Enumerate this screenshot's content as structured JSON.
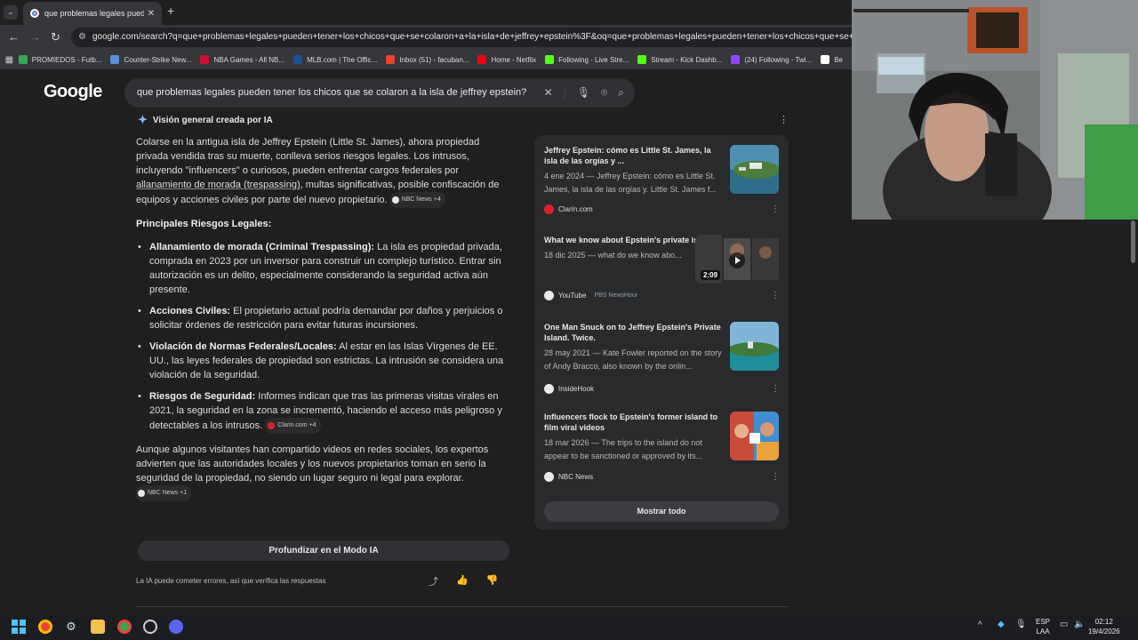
{
  "browser": {
    "tab_title": "que problemas legales pueden",
    "url": "google.com/search?q=que+problemas+legales+pueden+tener+los+chicos+que+se+colaron+a+la+isla+de+jeffrey+epstein%3F&oq=que+problemas+legales+pueden+tener+los+chicos+que+se+colaron+a",
    "bookmarks": [
      {
        "label": "PROMIEDOS - Futb...",
        "color": "#3aa757"
      },
      {
        "label": "Counter-Strike New...",
        "color": "#5a8fd6"
      },
      {
        "label": "NBA Games - All NB...",
        "color": "#c8102e"
      },
      {
        "label": "MLB.com | The Offic...",
        "color": "#1d4f91"
      },
      {
        "label": "Inbox (51) - facuban...",
        "color": "#ea4335"
      },
      {
        "label": "Home - Netflix",
        "color": "#e50914"
      },
      {
        "label": "Following - Live Stre...",
        "color": "#53fc18"
      },
      {
        "label": "Stream - Kick Dashb...",
        "color": "#53fc18"
      },
      {
        "label": "(24) Following - Twi...",
        "color": "#9146ff"
      },
      {
        "label": "Be",
        "color": "#ffffff"
      }
    ]
  },
  "google": {
    "logo": "Google",
    "query": "que problemas legales pueden tener los chicos que se colaron a la isla de jeffrey epstein?"
  },
  "ai_overview": {
    "header": "Visión general creada por IA",
    "intro_1": "Colarse en la antigua isla de Jeffrey Epstein (Little St. James), ahora propiedad privada vendida tras su muerte, conlleva serios riesgos legales. Los intrusos, incluyendo \"influencers\" o curiosos, pueden enfrentar cargos federales por ",
    "intro_link": "allanamiento de morada (trespassing)",
    "intro_2": ", multas significativas, posible confiscación de equipos y acciones civiles por parte del nuevo propietario.",
    "intro_chip": "NBC News +4",
    "section_title": "Principales Riesgos Legales:",
    "risks": [
      {
        "title": "Allanamiento de morada (Criminal Trespassing):",
        "text": " La isla es propiedad privada, comprada en 2023 por un inversor para construir un complejo turístico. Entrar sin autorización es un delito, especialmente considerando la seguridad activa aún presente.",
        "chip": ""
      },
      {
        "title": "Acciones Civiles:",
        "text": " El propietario actual podría demandar por daños y perjuicios o solicitar órdenes de restricción para evitar futuras incursiones.",
        "chip": ""
      },
      {
        "title": "Violación de Normas Federales/Locales:",
        "text": " Al estar en las Islas Vírgenes de EE. UU., las leyes federales de propiedad son estrictas. La intrusión se considera una violación de la seguridad.",
        "chip": ""
      },
      {
        "title": "Riesgos de Seguridad:",
        "text": " Informes indican que tras las primeras visitas virales en 2021, la seguridad en la zona se incrementó, haciendo el acceso más peligroso y detectables a los intrusos.",
        "chip": "Clarin.com +4"
      }
    ],
    "outro": "Aunque algunos visitantes han compartido videos en redes sociales, los expertos advierten que las autoridades locales y los nuevos propietarios toman en serio la seguridad de la propiedad, no siendo un lugar seguro ni legal para explorar.",
    "outro_chip": "NBC News +1",
    "deep_button": "Profundizar en el Modo IA",
    "disclaimer": "La IA puede cometer errores, así que verifica las respuestas"
  },
  "sources": [
    {
      "title": "Jeffrey Epstein: cómo es Little St. James, la isla de las orgías y ...",
      "desc": "4 ene 2024 — Jeffrey Epstein: cómo es Little St. James, la isla de las orgías y. Little St. James f...",
      "site": "Clarín.com",
      "sub": "",
      "site_color": "#d9202c",
      "duration": ""
    },
    {
      "title": "What we know about Epstein's private islands",
      "desc": "18 dic 2025 — what do we know abo...",
      "site": "YouTube",
      "sub": "PBS NewsHour",
      "site_color": "#e8e8e8",
      "duration": "2:09"
    },
    {
      "title": "One Man Snuck on to Jeffrey Epstein's Private Island. Twice.",
      "desc": "28 may 2021 — Kate Fowler reported on the story of Andy Bracco, also known by the onlin...",
      "site": "InsideHook",
      "sub": "",
      "site_color": "#e8e8e8",
      "duration": ""
    },
    {
      "title": "Influencers flock to Epstein's former island to film viral videos",
      "desc": "18 mar 2026 — The trips to the island do not appear to be sanctioned or approved by its...",
      "site": "NBC News",
      "sub": "",
      "site_color": "#e8e8e8",
      "duration": ""
    }
  ],
  "show_all": "Mostrar todo",
  "taskbar": {
    "lang_1": "ESP",
    "lang_2": "LAA",
    "time": "02:12",
    "date": "19/4/2026"
  }
}
